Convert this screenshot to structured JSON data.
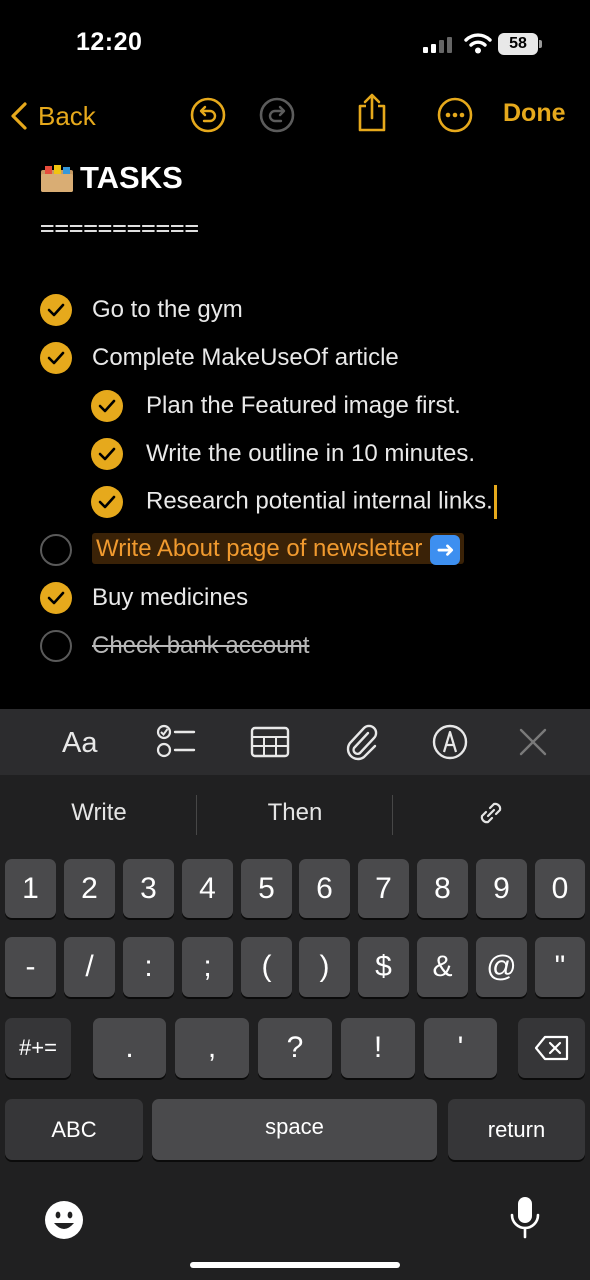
{
  "status_bar": {
    "time": "12:20",
    "battery": "58"
  },
  "toolbar": {
    "back_label": "Back",
    "done_label": "Done"
  },
  "note": {
    "title": "TASKS",
    "divider": "==========="
  },
  "tasks": [
    {
      "label": "Go to the gym",
      "checked": true
    },
    {
      "label": "Complete MakeUseOf article",
      "checked": true
    },
    {
      "label": "Plan the Featured image first.",
      "checked": true
    },
    {
      "label": "Write the outline in 10 minutes.",
      "checked": true
    },
    {
      "label": "Research potential internal links.",
      "checked": true
    },
    {
      "label": "Write About page of newsletter",
      "checked": false
    },
    {
      "label": "Buy medicines",
      "checked": true
    },
    {
      "label": "Check bank account",
      "checked": false
    }
  ],
  "format_bar": {
    "text_style_label": "Aa"
  },
  "keyboard": {
    "suggestions": [
      "Write",
      "Then"
    ],
    "row1": [
      "1",
      "2",
      "3",
      "4",
      "5",
      "6",
      "7",
      "8",
      "9",
      "0"
    ],
    "row2": [
      "-",
      "/",
      ":",
      ";",
      "(",
      ")",
      "$",
      "&",
      "@",
      "\""
    ],
    "row3": [
      ".",
      ",",
      "?",
      "!",
      "'"
    ],
    "symbols_key": "#+=",
    "abc_key": "ABC",
    "space_key": "space",
    "return_key": "return"
  },
  "colors": {
    "accent": "#e6a91c",
    "highlight_text": "#f09a2f",
    "background": "#000000"
  }
}
